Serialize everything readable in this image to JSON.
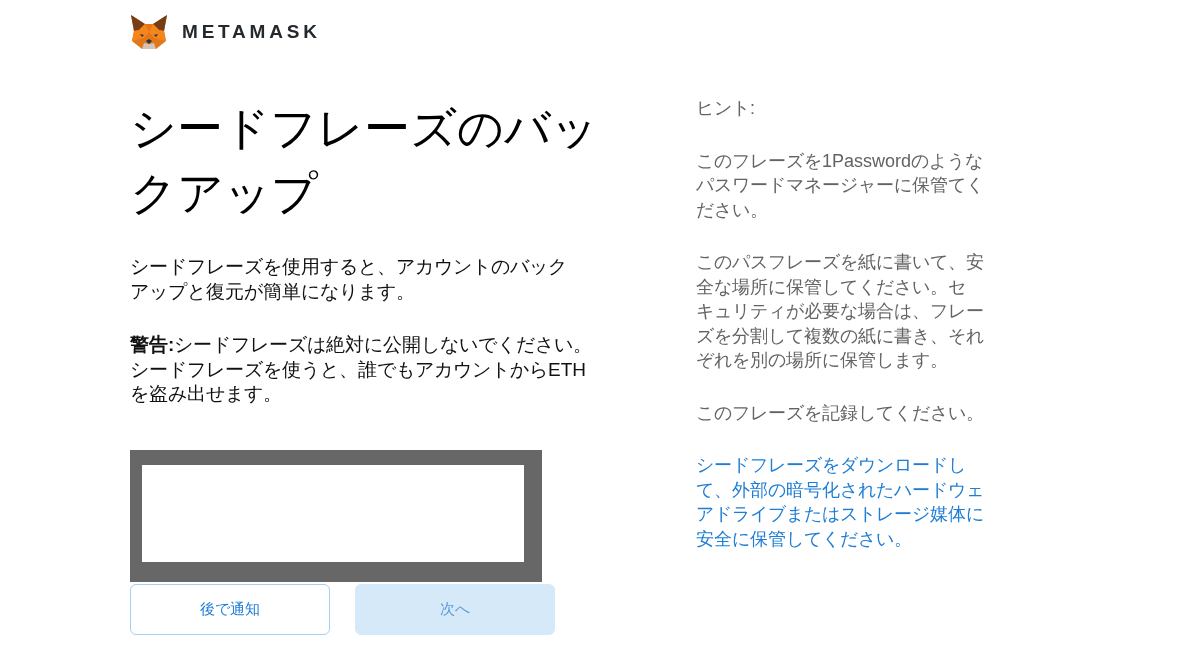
{
  "header": {
    "logo_text": "METAMASK"
  },
  "main": {
    "title": "シードフレーズのバックアップ",
    "paragraphs": [
      "シードフレーズを使用すると、アカウントのバックアップと復元が簡単になります。",
      "**警告:**シードフレーズは絶対に公開しないでください。シードフレーズを使うと、誰でもアカウントからETHを盗み出せます。"
    ],
    "buttons": [
      {
        "label": "後で通知",
        "kind": "secondary",
        "disabled": false
      },
      {
        "label": "次へ",
        "kind": "primary",
        "disabled": true
      }
    ]
  },
  "tips": {
    "heading": "ヒント:",
    "items": [
      {
        "kind": "text",
        "text": "このフレーズを1Passwordのようなパスワードマネージャーに保管てください。"
      },
      {
        "kind": "text",
        "text": "このパスフレーズを紙に書いて、安全な場所に保管してください。セキュリティが必要な場合は、フレーズを分割して複数の紙に書き、それぞれを別の場所に保管します。"
      },
      {
        "kind": "text",
        "text": "このフレーズを記録してください。"
      },
      {
        "kind": "link",
        "text": "シードフレーズをダウンロードして、外部の暗号化されたハードウェアドライブまたはストレージ媒体に安全に保管してください。"
      }
    ]
  }
}
